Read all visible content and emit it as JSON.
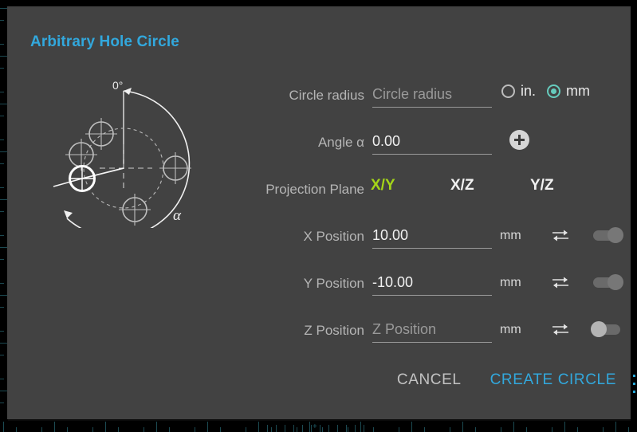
{
  "dialog": {
    "title": "Arbitrary Hole Circle"
  },
  "diagram": {
    "zero_label": "0°",
    "angle_label": "α",
    "name": "hole-circle-diagram"
  },
  "fields": {
    "circle_radius": {
      "label": "Circle radius",
      "value": "",
      "placeholder": "Circle radius"
    },
    "angle": {
      "label": "Angle α",
      "value": "0.00",
      "placeholder": "Angle α"
    },
    "x_position": {
      "label": "X Position",
      "value": "10.00",
      "placeholder": "X Position",
      "unit": "mm",
      "toggle_state": "on"
    },
    "y_position": {
      "label": "Y Position",
      "value": "-10.00",
      "placeholder": "Y Position",
      "unit": "mm",
      "toggle_state": "on"
    },
    "z_position": {
      "label": "Z Position",
      "value": "",
      "placeholder": "Z Position",
      "unit": "mm",
      "toggle_state": "off"
    }
  },
  "units": {
    "options": [
      "in.",
      "mm"
    ],
    "selected": "mm",
    "inch_label": "in.",
    "mm_label": "mm"
  },
  "projection_plane": {
    "label": "Projection Plane",
    "options": [
      "X/Y",
      "X/Z",
      "Y/Z"
    ],
    "selected": "X/Y",
    "xy_label": "X/Y",
    "xz_label": "X/Z",
    "yz_label": "Y/Z"
  },
  "footer": {
    "cancel_label": "CANCEL",
    "create_label": "CREATE CIRCLE"
  },
  "colors": {
    "accent_blue": "#32a8dd",
    "accent_green": "#a4d518",
    "accent_teal": "#66cbbd",
    "dialog_bg": "#424242",
    "canvas_bg": "#0a0a0a",
    "ruler_tick": "#1c4a52"
  }
}
